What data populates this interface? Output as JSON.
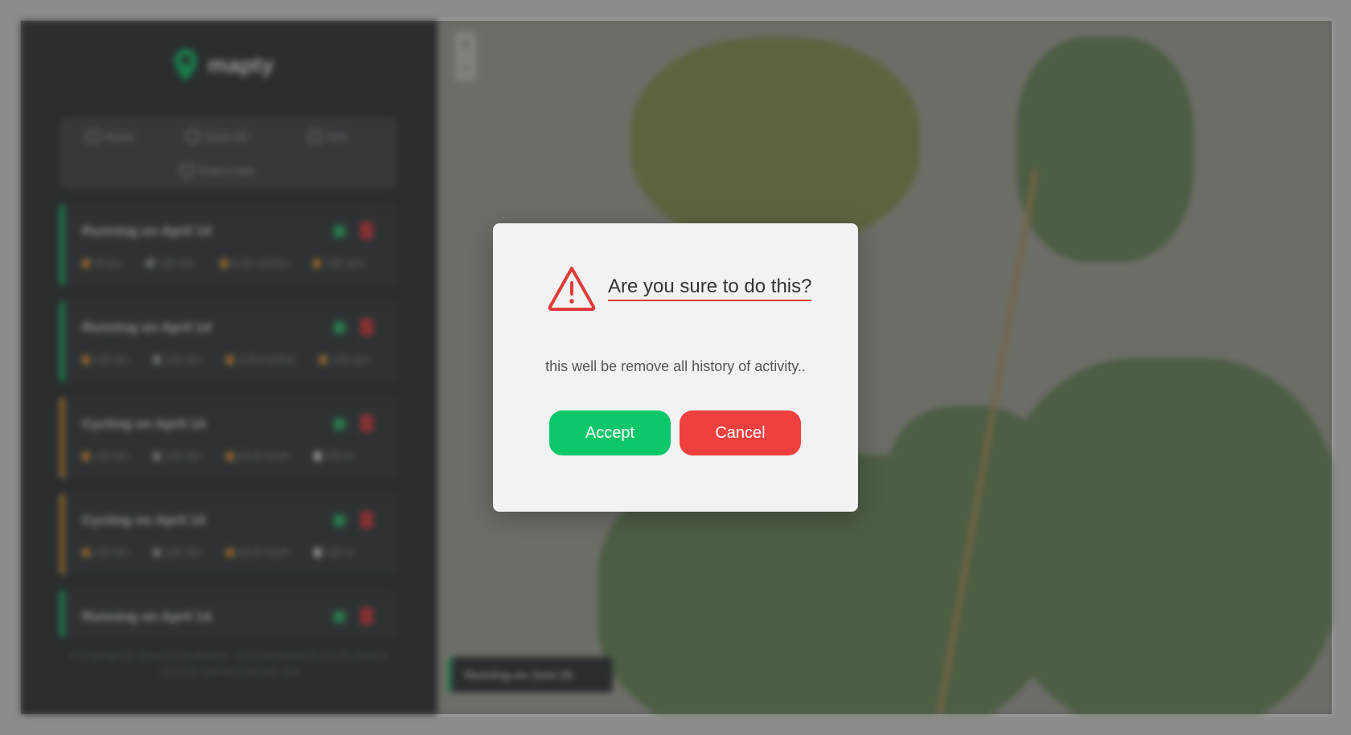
{
  "app": {
    "logo_text": "mapty"
  },
  "controls": {
    "reset": "Reset",
    "show_all": "Show All",
    "sort": "Sort",
    "draw_lines": "Draw Lines"
  },
  "workouts": [
    {
      "title": "Running on April 14",
      "type": "running",
      "color": "#0cc76a",
      "stats": [
        "20 km",
        "120 min",
        "6.00 min/km",
        "165 spm"
      ]
    },
    {
      "title": "Running on April 14",
      "type": "running",
      "color": "#0cc76a",
      "stats": [
        "120 km",
        "120 min",
        "1.00 min/km",
        "100 spm"
      ]
    },
    {
      "title": "Cycling on April 14",
      "type": "cycling",
      "color": "#e3952b",
      "stats": [
        "120 km",
        "120 min",
        "60.00 km/h",
        "200 m"
      ]
    },
    {
      "title": "Cycling on April 14",
      "type": "cycling",
      "color": "#e3952b",
      "stats": [
        "100 km",
        "100 min",
        "60.00 km/h",
        "100 m"
      ]
    },
    {
      "title": "Running on April 14",
      "type": "running",
      "color": "#0cc76a",
      "stats": []
    }
  ],
  "copyright": "© Copyright by Jonas Schmedtmann. This is developed by me for practice. Use it for learning purposes only.",
  "map": {
    "popup_text": "Running on June 29",
    "zoom_in": "+",
    "zoom_out": "−"
  },
  "modal": {
    "title": "Are you sure to do this?",
    "message": "this well be remove all history of activity..",
    "accept_label": "Accept",
    "cancel_label": "Cancel",
    "icon": "warning-triangle-icon"
  },
  "colors": {
    "accept": "#0cc76a",
    "cancel": "#ef4040",
    "warning": "#e03b3b"
  }
}
